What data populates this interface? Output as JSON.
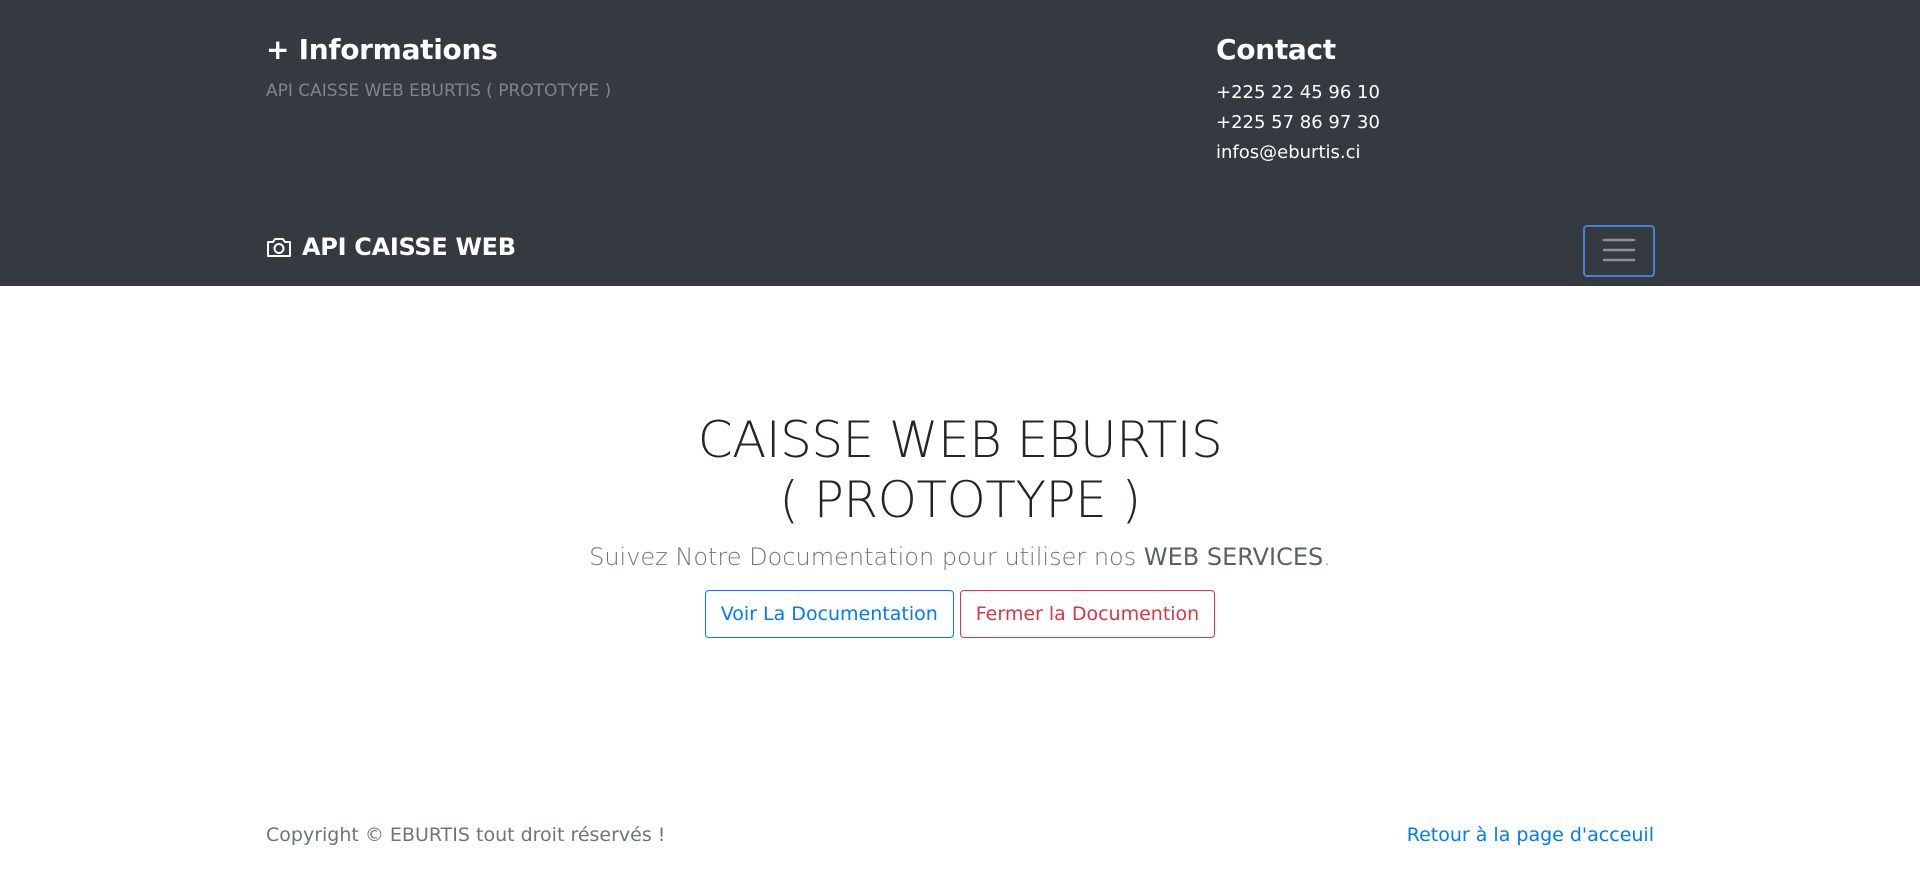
{
  "info": {
    "title": "+ Informations",
    "text": "API CAISSE WEB EBURTIS ( PROTOTYPE )"
  },
  "contact": {
    "title": "Contact",
    "phone1": "+225 22 45 96 10",
    "phone2": "+225 57 86 97 30",
    "email": "infos@eburtis.ci"
  },
  "navbar": {
    "brand_icon": "camera-icon",
    "brand": "API CAISSE WEB",
    "toggler_icon": "hamburger-menu-icon"
  },
  "hero": {
    "title_line1": "CAISSE WEB EBURTIS",
    "title_line2": "( PROTOTYPE )",
    "lead_prefix": "Suivez Notre Documentation pour utiliser nos ",
    "lead_strong": "WEB SERVICES",
    "lead_suffix": ".",
    "btn_view": "Voir La Documentation",
    "btn_close": "Fermer la Documention"
  },
  "footer": {
    "copyright": "Copyright © EBURTIS tout droit réservés !",
    "back_link": "Retour à la page d'acceuil"
  },
  "colors": {
    "dark_bg": "#343a40",
    "primary": "#007bff",
    "danger": "#dc3545",
    "muted": "#6c757d"
  }
}
